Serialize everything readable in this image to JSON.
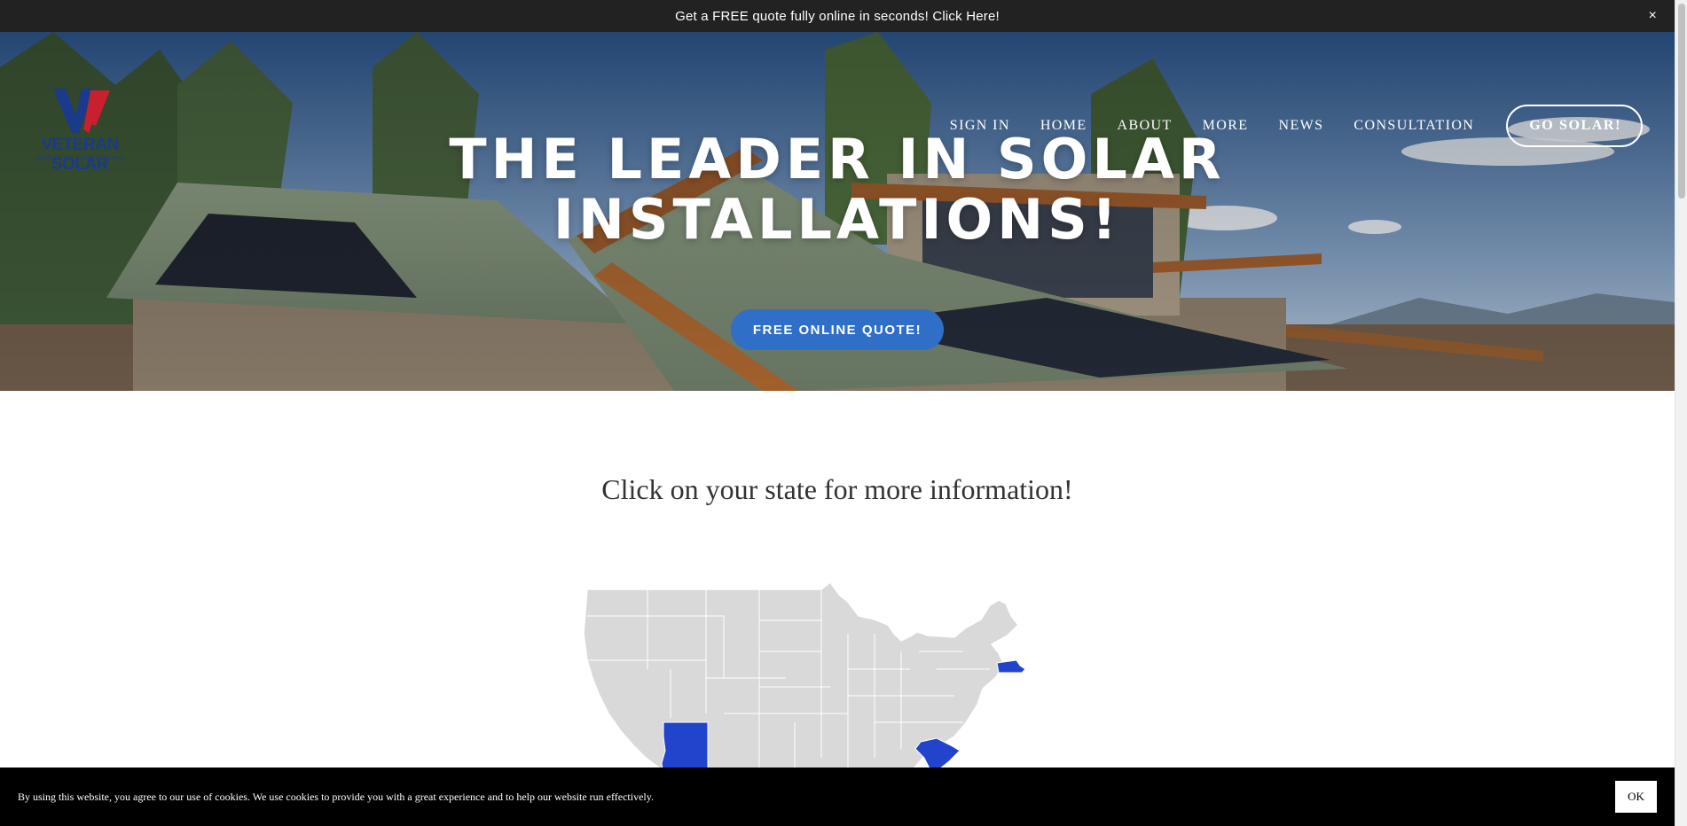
{
  "announcement": {
    "text": "Get a FREE quote fully online in seconds! Click Here!",
    "close_glyph": "×"
  },
  "brand": {
    "name": "VETERAN SOLAR",
    "tagline": "SUPPORTING OUR VETERANS",
    "colors": {
      "blue": "#1a3a8c",
      "red": "#c8202f"
    }
  },
  "nav": {
    "items": [
      {
        "label": "SIGN IN"
      },
      {
        "label": "HOME"
      },
      {
        "label": "ABOUT"
      },
      {
        "label": "MORE"
      },
      {
        "label": "NEWS"
      },
      {
        "label": "CONSULTATION"
      }
    ],
    "cta": "GO SOLAR!"
  },
  "hero": {
    "title_line1": "THE LEADER IN SOLAR",
    "title_line2": "INSTALLATIONS!",
    "button": "FREE ONLINE QUOTE!",
    "button_color": "#2f6fc7"
  },
  "map_section": {
    "heading": "Click on your state for more information!",
    "highlighted_states": [
      "Arizona",
      "South Carolina",
      "Massachusetts"
    ],
    "highlight_color": "#2244cc",
    "default_color": "#d9d9d9"
  },
  "cookie": {
    "text": "By using this website, you agree to our use of cookies. We use cookies to provide you with a great experience and to help our website run effectively.",
    "ok": "OK"
  }
}
